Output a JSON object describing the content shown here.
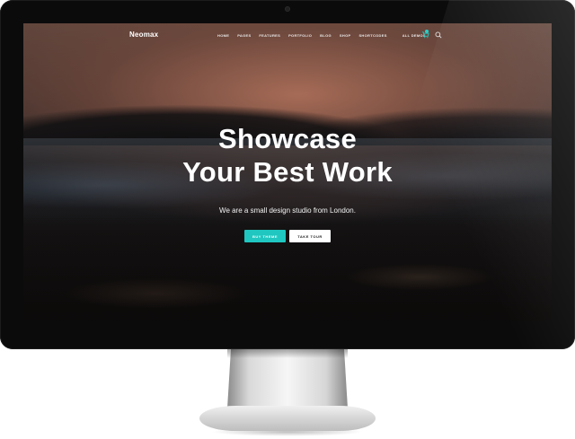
{
  "site": {
    "logo": "Neomax",
    "menu": [
      "HOME",
      "PAGES",
      "FEATURES",
      "PORTFOLIO",
      "BLOG",
      "SHOP",
      "SHORTCODES"
    ],
    "extra_link": "ALL DEMOS"
  },
  "hero": {
    "title_line1": "Showcase",
    "title_line2": "Your Best Work",
    "subtitle": "We are a small design studio from London.",
    "buttons": {
      "primary": "BUY THEME",
      "secondary": "TAKE TOUR"
    }
  },
  "icons": {
    "cart": "cart-icon",
    "search": "search-icon"
  },
  "colors": {
    "accent": "#1fc7c0",
    "screen_bg": "#0b0b0b",
    "text": "#ffffff"
  }
}
